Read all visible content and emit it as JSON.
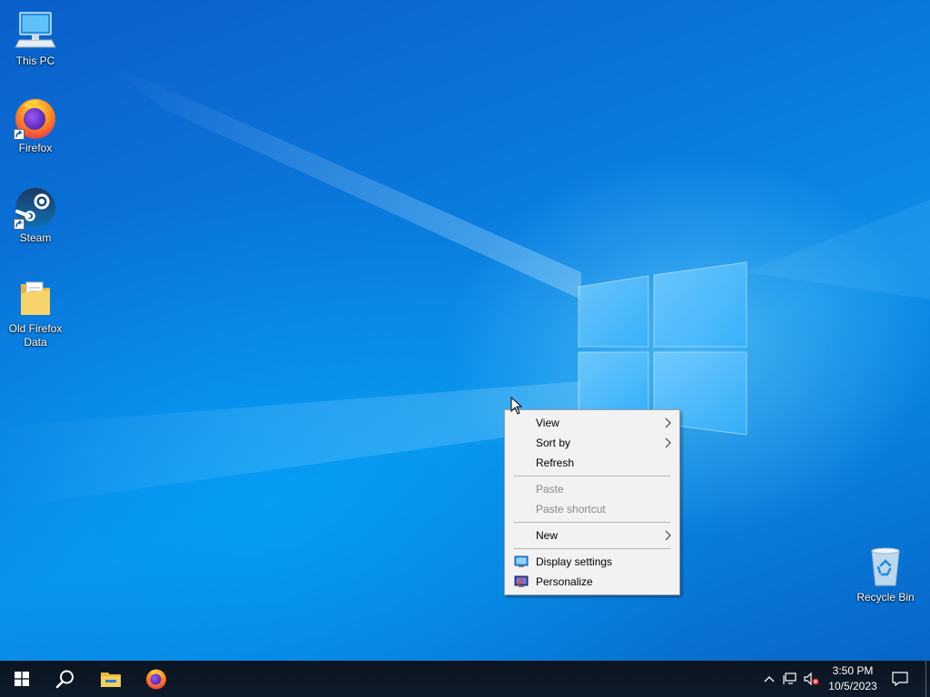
{
  "desktop_icons": [
    {
      "label": "This PC",
      "icon": "this-pc-icon"
    },
    {
      "label": "Firefox",
      "icon": "firefox-icon",
      "shortcut": true
    },
    {
      "label": "Steam",
      "icon": "steam-icon",
      "shortcut": true
    },
    {
      "label": "Old Firefox Data",
      "icon": "folder-icon"
    },
    {
      "label": "Recycle Bin",
      "icon": "recycle-bin-icon"
    }
  ],
  "context_menu": {
    "items": [
      {
        "label": "View",
        "submenu": true,
        "enabled": true
      },
      {
        "label": "Sort by",
        "submenu": true,
        "enabled": true
      },
      {
        "label": "Refresh",
        "enabled": true
      },
      {
        "label": "Paste",
        "enabled": false
      },
      {
        "label": "Paste shortcut",
        "enabled": false
      },
      {
        "label": "New",
        "submenu": true,
        "enabled": true
      },
      {
        "label": "Display settings",
        "icon": "display-settings-icon",
        "enabled": true
      },
      {
        "label": "Personalize",
        "icon": "personalize-icon",
        "enabled": true
      }
    ]
  },
  "taskbar": {
    "clock": {
      "time": "3:50 PM",
      "date": "10/5/2023"
    },
    "pinned": [
      "start-icon",
      "search-icon",
      "file-explorer-icon",
      "firefox-icon"
    ],
    "tray": [
      "chevron-up-icon",
      "network-icon",
      "volume-muted-icon",
      "notifications-icon"
    ]
  },
  "colors": {
    "desktop_blue": "#0a78dc",
    "taskbar": "#0e1b2a",
    "menu_bg": "#f2f2f2"
  }
}
